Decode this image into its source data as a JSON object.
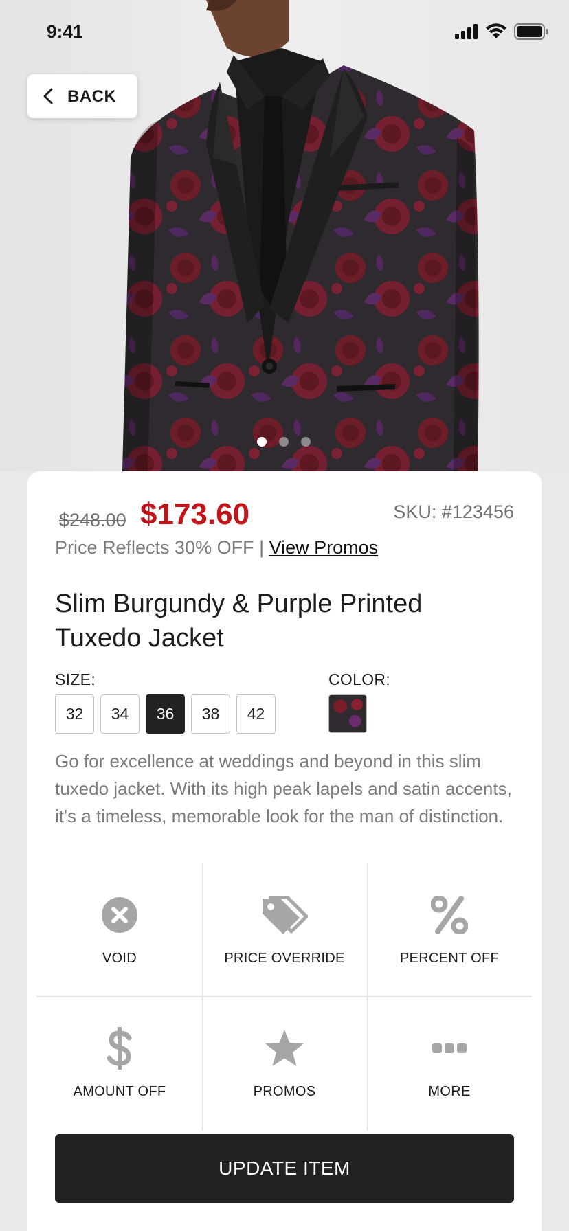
{
  "status_bar": {
    "time": "9:41"
  },
  "header": {
    "back_label": "BACK"
  },
  "gallery": {
    "image_count": 3,
    "active_index": 0
  },
  "pricing": {
    "original_price": "$248.00",
    "sale_price": "$173.60",
    "sku": "SKU: #123456",
    "discount_text": "Price Reflects 30% OFF |",
    "promo_link": "View Promos"
  },
  "product": {
    "title": "Slim Burgundy & Purple Printed Tuxedo Jacket",
    "description": "Go for excellence at weddings and beyond in this slim tuxedo jacket. With its high peak lapels and satin accents, it's a timeless, memorable look for the man of distinction."
  },
  "size": {
    "label": "SIZE:",
    "options": [
      "32",
      "34",
      "36",
      "38",
      "42"
    ],
    "selected": "36"
  },
  "color": {
    "label": "COLOR:"
  },
  "actions": [
    {
      "label": "VOID",
      "icon": "void-x-circle-icon"
    },
    {
      "label": "PRICE OVERRIDE",
      "icon": "price-tag-icon"
    },
    {
      "label": "PERCENT OFF",
      "icon": "percent-icon"
    },
    {
      "label": "AMOUNT OFF",
      "icon": "dollar-icon"
    },
    {
      "label": "PROMOS",
      "icon": "star-icon"
    },
    {
      "label": "MORE",
      "icon": "more-dots-icon"
    }
  ],
  "primary_button": {
    "label": "UPDATE ITEM"
  },
  "colors": {
    "sale_red": "#c0151b",
    "primary_dark": "#222222",
    "muted_text": "#7c7c7c",
    "icon_gray": "#a6a6a6"
  }
}
